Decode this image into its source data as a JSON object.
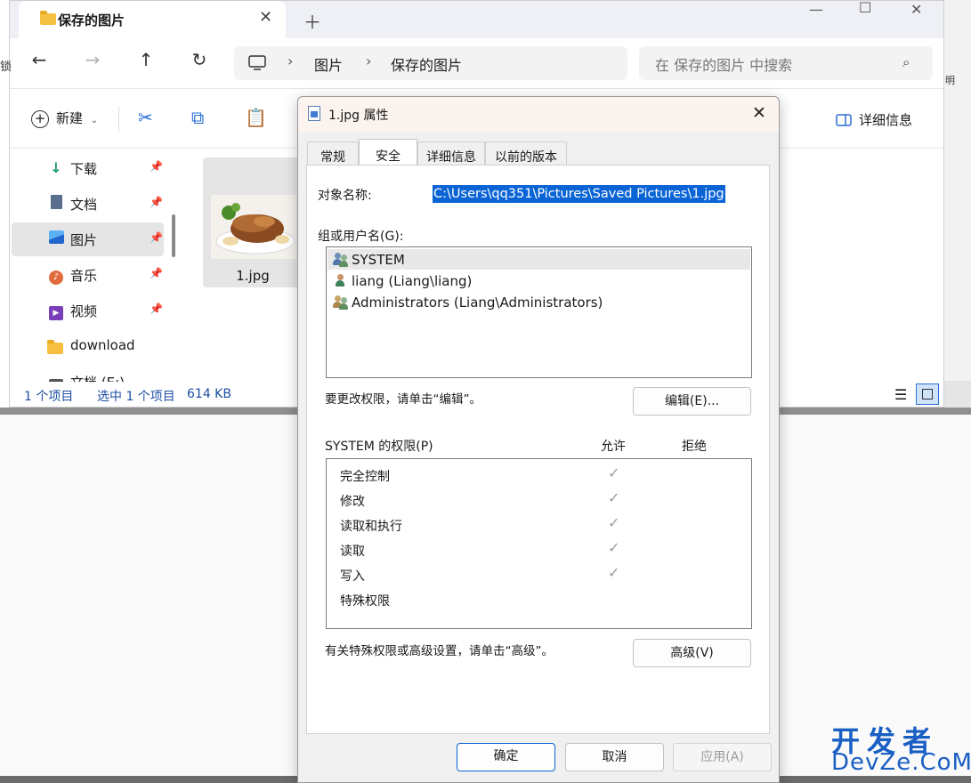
{
  "explorer": {
    "tab_title": "保存的图片",
    "breadcrumb": [
      "图片",
      "保存的图片"
    ],
    "search_placeholder": "在 保存的图片 中搜索",
    "toolbar": {
      "new_label": "新建",
      "details_label": "详细信息"
    },
    "sidebar": [
      {
        "label": "下载",
        "icon": "download-icon",
        "pinned": true
      },
      {
        "label": "文档",
        "icon": "document-icon",
        "pinned": true
      },
      {
        "label": "图片",
        "icon": "pictures-icon",
        "pinned": true,
        "selected": true
      },
      {
        "label": "音乐",
        "icon": "music-icon",
        "pinned": true
      },
      {
        "label": "视频",
        "icon": "video-icon",
        "pinned": true
      },
      {
        "label": "download",
        "icon": "folder-icon",
        "pinned": false
      },
      {
        "label": "文档 (E:)",
        "icon": "drive-icon",
        "pinned": false
      }
    ],
    "file": {
      "name": "1.jpg"
    },
    "status": {
      "count": "1 个项目",
      "selected": "选中 1 个项目",
      "size": "614 KB"
    },
    "edge_left_text": "锁",
    "edge_right_text": "明"
  },
  "dialog": {
    "title": "1.jpg 属性",
    "tabs": [
      "常规",
      "安全",
      "详细信息",
      "以前的版本"
    ],
    "active_tab": "安全",
    "object_label": "对象名称:",
    "object_value": "C:\\Users\\qq351\\Pictures\\Saved Pictures\\1.jpg",
    "group_label": "组或用户名(G):",
    "users": [
      {
        "name": "SYSTEM",
        "selected": true
      },
      {
        "name": "liang (Liang\\liang)",
        "selected": false
      },
      {
        "name": "Administrators (Liang\\Administrators)",
        "selected": false
      }
    ],
    "edit_hint": "要更改权限，请单击“编辑”。",
    "edit_button": "编辑(E)...",
    "perm_label": "SYSTEM 的权限(P)",
    "allow_header": "允许",
    "deny_header": "拒绝",
    "permissions": [
      {
        "name": "完全控制",
        "allow": true
      },
      {
        "name": "修改",
        "allow": true
      },
      {
        "name": "读取和执行",
        "allow": true
      },
      {
        "name": "读取",
        "allow": true
      },
      {
        "name": "写入",
        "allow": true
      },
      {
        "name": "特殊权限",
        "allow": false
      }
    ],
    "advanced_hint": "有关特殊权限或高级设置，请单击“高级”。",
    "advanced_button": "高级(V)",
    "ok_button": "确定",
    "cancel_button": "取消",
    "apply_button": "应用(A)"
  },
  "watermark": {
    "line1": "开发者",
    "line2": "DevZe.CoM"
  },
  "colors": {
    "selection": "#0a64d6",
    "accent": "#1c4ea3"
  }
}
